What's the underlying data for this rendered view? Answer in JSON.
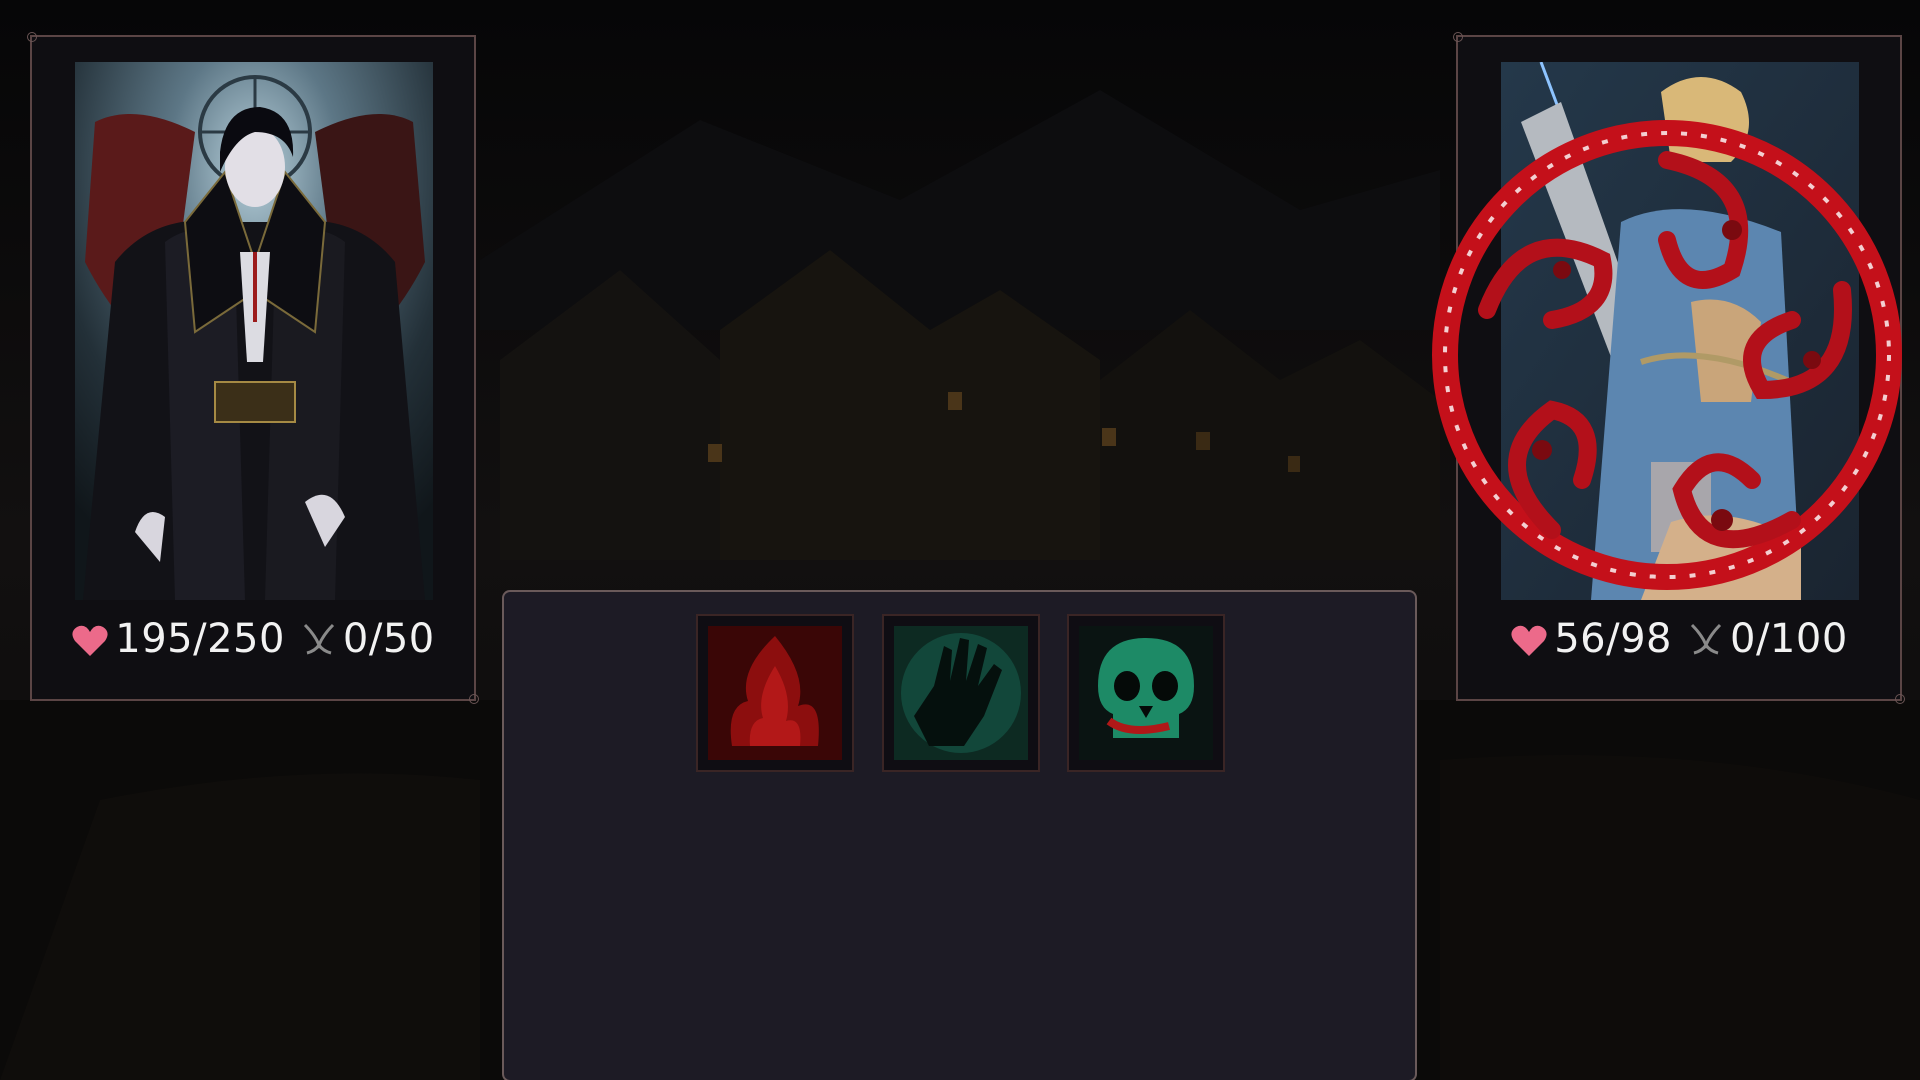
{
  "player": {
    "hp": "195/250",
    "mana": "0/50",
    "portrait": "vampire-lord-portrait"
  },
  "enemy": {
    "hp": "56/98",
    "mana": "0/100",
    "portrait": "armored-swordswoman-portrait",
    "status_effect": "blood-curse-sigil"
  },
  "skills": [
    {
      "icon": "blood-flame-icon",
      "color": "#b01818"
    },
    {
      "icon": "shadow-hand-icon",
      "color": "#1d8a66"
    },
    {
      "icon": "cursed-skull-icon",
      "color": "#1d8a66"
    }
  ],
  "colors": {
    "heart": "#ec6a8a",
    "panel_border": "#5b4545",
    "blood": "#c4101a"
  }
}
